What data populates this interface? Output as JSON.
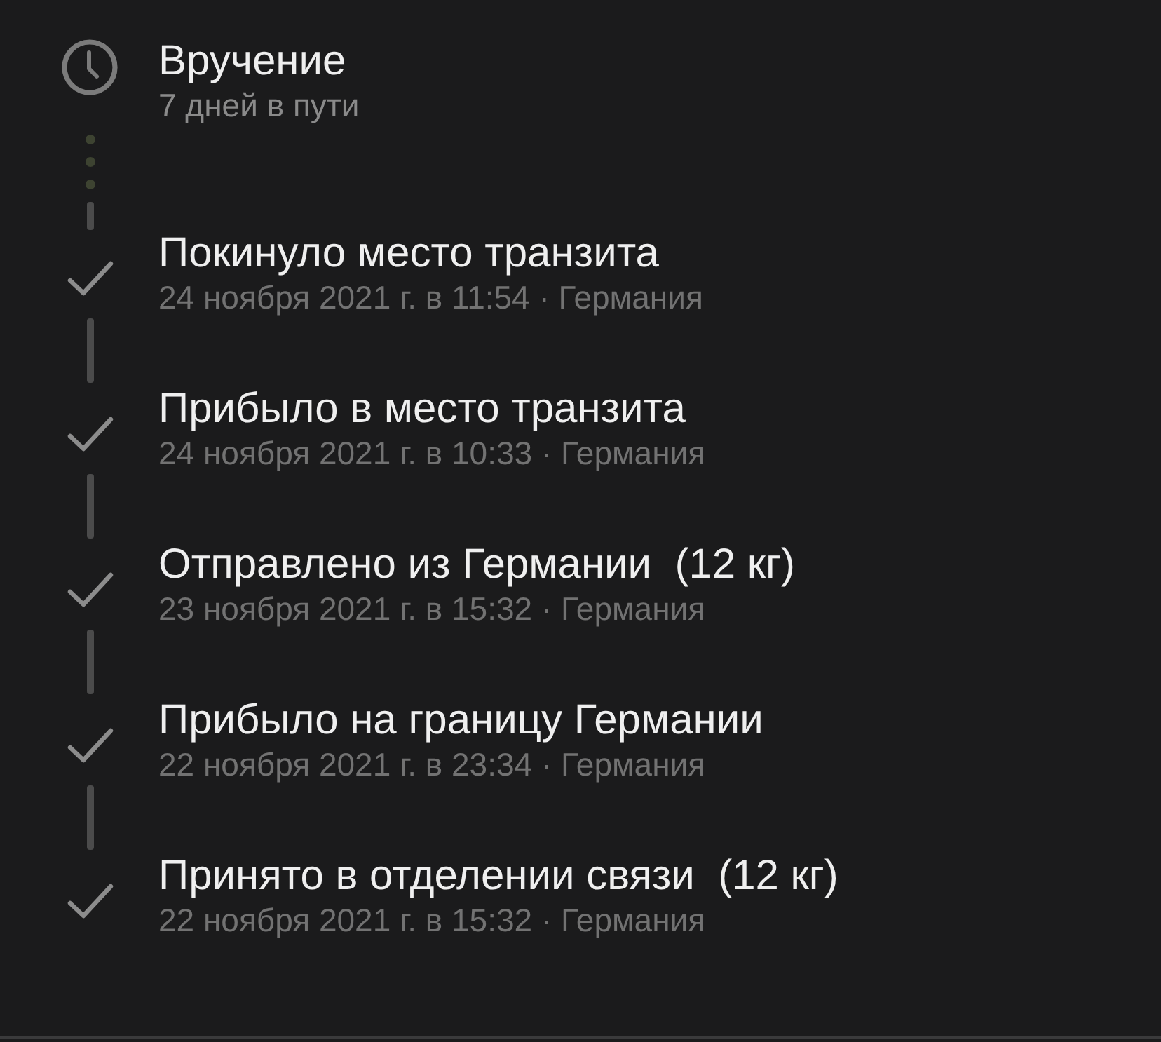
{
  "steps": [
    {
      "kind": "pending",
      "title": "Вручение",
      "subtitle": "7 дней в пути"
    },
    {
      "kind": "done",
      "title": "Покинуло место транзита",
      "subtitle": "24 ноября 2021 г. в 11:54 · Германия"
    },
    {
      "kind": "done",
      "title": "Прибыло в место транзита",
      "subtitle": "24 ноября 2021 г. в 10:33 · Германия"
    },
    {
      "kind": "done",
      "title": "Отправлено из Германии  (12 кг)",
      "subtitle": "23 ноября 2021 г. в 15:32 · Германия"
    },
    {
      "kind": "done",
      "title": "Прибыло на границу Германии",
      "subtitle": "22 ноября 2021 г. в 23:34 · Германия"
    },
    {
      "kind": "done",
      "title": "Принято в отделении связи  (12 кг)",
      "subtitle": "22 ноября 2021 г. в 15:32 · Германия"
    }
  ]
}
